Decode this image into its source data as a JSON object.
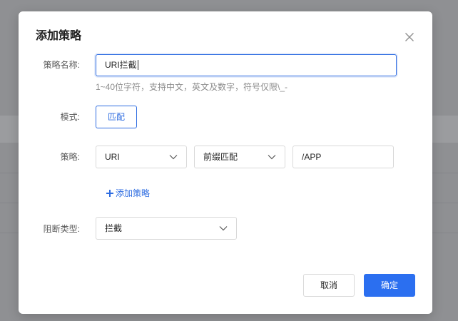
{
  "modal": {
    "title": "添加策略",
    "close_icon": "close-icon"
  },
  "form": {
    "name_label": "策略名称:",
    "name_value": "URI拦截",
    "name_hint": "1~40位字符，支持中文，英文及数字，符号仅限\\_-",
    "mode_label": "模式:",
    "mode_value": "匹配",
    "policy_label": "策略:",
    "policy_field_select": "URI",
    "policy_match_select": "前缀匹配",
    "policy_value": "/APP",
    "add_policy_label": "添加策略",
    "block_type_label": "阻断类型:",
    "block_type_value": "拦截"
  },
  "footer": {
    "cancel_label": "取消",
    "ok_label": "确定"
  },
  "colors": {
    "accent": "#2f6de1",
    "primary_button": "#2b6ff0",
    "overlay": "#8f9093"
  }
}
